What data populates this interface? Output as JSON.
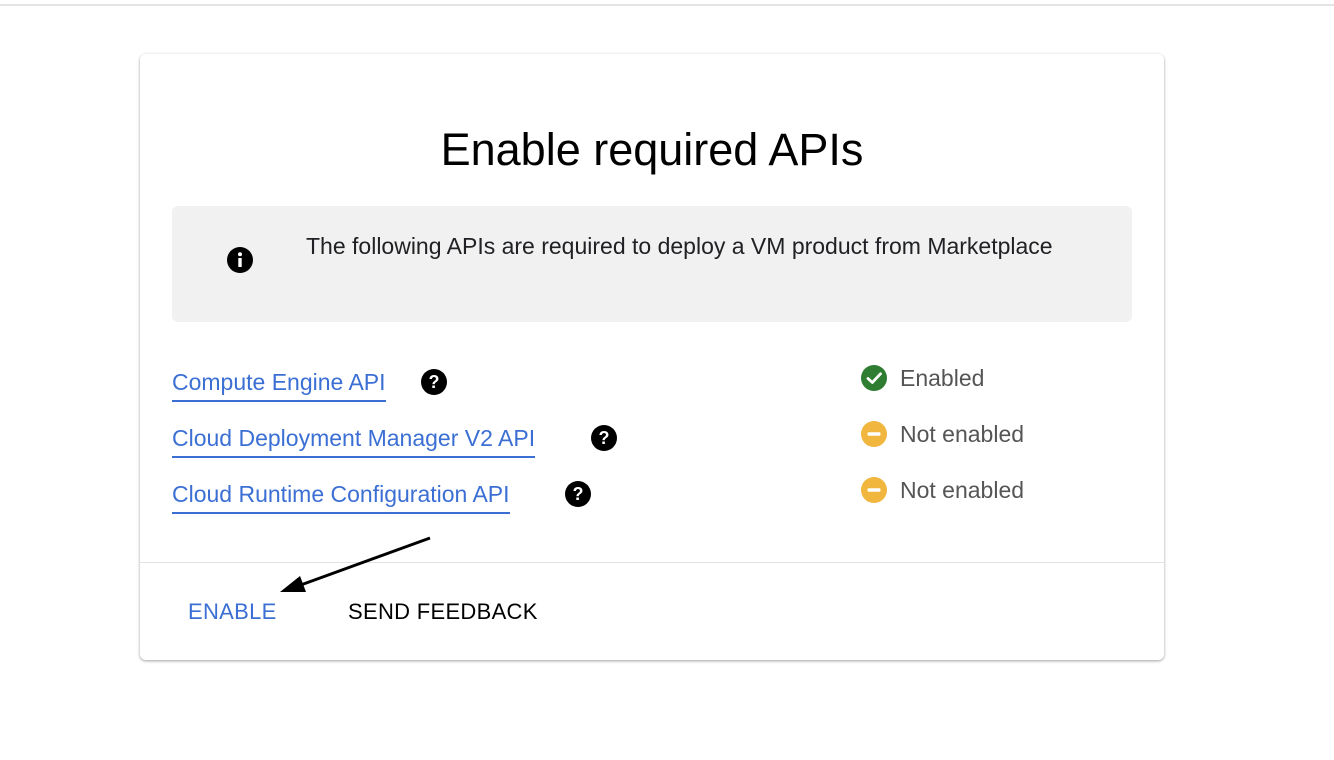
{
  "dialog": {
    "title": "Enable required APIs",
    "info_text": "The following APIs are required to deploy a VM product from Marketplace"
  },
  "apis": [
    {
      "name": "Compute Engine API",
      "status": "Enabled",
      "status_icon": "check-circle-icon",
      "status_color": "#2e7d32"
    },
    {
      "name": "Cloud Deployment Manager V2 API",
      "status": "Not enabled",
      "status_icon": "minus-circle-icon",
      "status_color": "#f0b63d"
    },
    {
      "name": "Cloud Runtime Configuration API",
      "status": "Not enabled",
      "status_icon": "minus-circle-icon",
      "status_color": "#f0b63d"
    }
  ],
  "actions": {
    "enable_label": "ENABLE",
    "feedback_label": "SEND FEEDBACK"
  },
  "colors": {
    "link": "#3b6fd4",
    "enabled": "#2e7d32",
    "not_enabled": "#f0b63d"
  }
}
